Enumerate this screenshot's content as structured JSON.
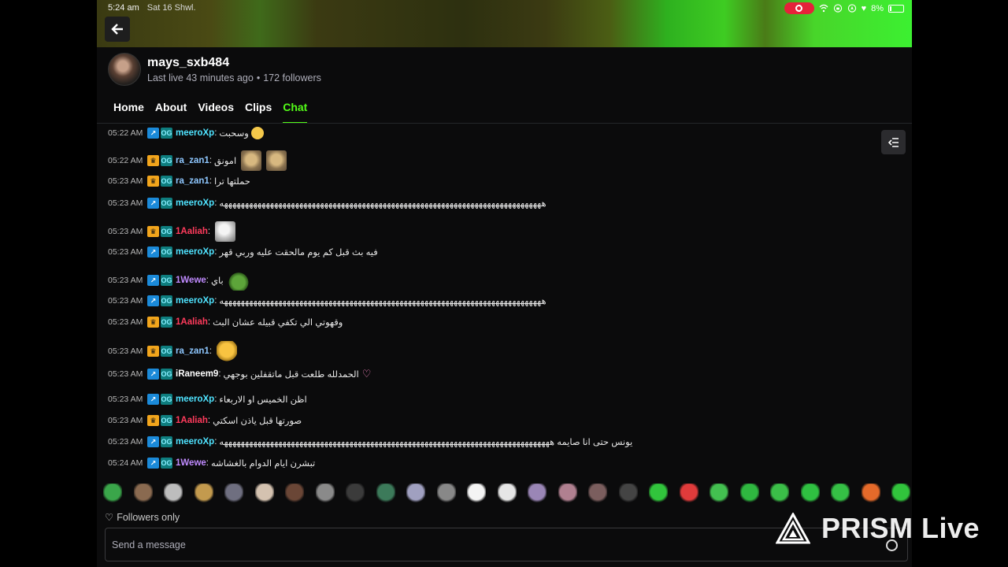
{
  "status_bar": {
    "time": "5:24 am",
    "date": "Sat 16 Shwl.",
    "battery": "8%"
  },
  "channel": {
    "username": "mays_sxb484",
    "last_live": "Last live 43 minutes ago",
    "followers": "172 followers"
  },
  "tabs": [
    {
      "label": "Home",
      "active": false
    },
    {
      "label": "About",
      "active": false
    },
    {
      "label": "Videos",
      "active": false
    },
    {
      "label": "Clips",
      "active": false
    },
    {
      "label": "Chat",
      "active": true
    }
  ],
  "colors": {
    "accent": "#53fc18",
    "user_meero": "#4fe3ff",
    "user_razan": "#8ec7ff",
    "user_aaliah": "#ff3b5c",
    "user_wewe": "#c08bff",
    "user_iraneem": "#ffffff"
  },
  "chat": [
    {
      "time": "05:22 AM",
      "badges": [
        "arrow-badge-icon",
        "og-badge-icon"
      ],
      "user": "meeroXp",
      "color": "#4fe3ff",
      "text": "وسحبت",
      "emotes": [
        "small-smile"
      ]
    },
    {
      "time": "05:22 AM",
      "badges": [
        "crown-badge-icon",
        "og-badge-icon"
      ],
      "user": "ra_zan1",
      "color": "#8ec7ff",
      "text": "امونق",
      "emotes": [
        "bear",
        "bear"
      ]
    },
    {
      "time": "05:23 AM",
      "badges": [
        "crown-badge-icon",
        "og-badge-icon"
      ],
      "user": "ra_zan1",
      "color": "#8ec7ff",
      "text": "حملتها ترا",
      "emotes": []
    },
    {
      "time": "05:23 AM",
      "badges": [
        "arrow-badge-icon",
        "og-badge-icon"
      ],
      "user": "meeroXp",
      "color": "#4fe3ff",
      "text": "هههههههههههههههههههههههههههههههههههههههههههههههههههههههههههههههههههههههههههههه",
      "emotes": []
    },
    {
      "time": "05:23 AM",
      "badges": [
        "crown-badge-icon",
        "og-badge-icon"
      ],
      "user": "1Aaliah",
      "color": "#ff3b5c",
      "text": "",
      "emotes": [
        "duck"
      ]
    },
    {
      "time": "05:23 AM",
      "badges": [
        "arrow-badge-icon",
        "og-badge-icon"
      ],
      "user": "meeroXp",
      "color": "#4fe3ff",
      "text": "فيه بث قبل كم يوم مالحقت عليه وربي قهر",
      "emotes": []
    },
    {
      "time": "05:23 AM",
      "badges": [
        "arrow-badge-icon",
        "og-badge-icon"
      ],
      "user": "1Wewe",
      "color": "#c08bff",
      "text": "باي",
      "emotes": [
        "frog"
      ]
    },
    {
      "time": "05:23 AM",
      "badges": [
        "arrow-badge-icon",
        "og-badge-icon"
      ],
      "user": "meeroXp",
      "color": "#4fe3ff",
      "text": "هههههههههههههههههههههههههههههههههههههههههههههههههههههههههههههههههههههههههههههه",
      "emotes": []
    },
    {
      "time": "05:23 AM",
      "badges": [
        "crown-badge-icon",
        "og-badge-icon"
      ],
      "user": "1Aaliah",
      "color": "#ff3b5c",
      "text": "وقهوتي الي تكفي قبيله عشان البث",
      "emotes": []
    },
    {
      "time": "05:23 AM",
      "badges": [
        "crown-badge-icon",
        "og-badge-icon"
      ],
      "user": "ra_zan1",
      "color": "#8ec7ff",
      "text": "",
      "emotes": [
        "hug"
      ]
    },
    {
      "time": "05:23 AM",
      "badges": [
        "arrow-badge-icon",
        "og-badge-icon"
      ],
      "user": "iRaneem9",
      "color": "#ffffff",
      "text": "الحمدلله طلعت قبل ماتقفلين بوجهي",
      "emotes": [
        "heart"
      ]
    },
    {
      "time": "05:23 AM",
      "badges": [
        "arrow-badge-icon",
        "og-badge-icon"
      ],
      "user": "meeroXp",
      "color": "#4fe3ff",
      "text": "اظن الخميس او الاربعاء",
      "emotes": []
    },
    {
      "time": "05:23 AM",
      "badges": [
        "crown-badge-icon",
        "og-badge-icon"
      ],
      "user": "1Aaliah",
      "color": "#ff3b5c",
      "text": "صورتها قبل ياذن اسكتي",
      "emotes": []
    },
    {
      "time": "05:23 AM",
      "badges": [
        "arrow-badge-icon",
        "og-badge-icon"
      ],
      "user": "meeroXp",
      "color": "#4fe3ff",
      "text": "يونس حتى انا صايمه هههههههههههههههههههههههههههههههههههههههههههههههههههههههههههههههههههههههههههههههه",
      "emotes": []
    },
    {
      "time": "05:24 AM",
      "badges": [
        "arrow-badge-icon",
        "og-badge-icon"
      ],
      "user": "1Wewe",
      "color": "#c08bff",
      "text": "تبشرن ايام الدوام بالغشاشه",
      "emotes": []
    }
  ],
  "emote_strip": [
    "#3aa64a",
    "#8a6a50",
    "#bdbdbd",
    "#c39a4e",
    "#6f6f80",
    "#d4c2b0",
    "#6a4636",
    "#8a8a8a",
    "#3b3b3b",
    "#3c7a5a",
    "#a0a0c0",
    "#888888",
    "#f4f4f4",
    "#e6e6e6",
    "#9a86b6",
    "#b08090",
    "#7b5e5e",
    "#444444",
    "#31c43c",
    "#e03b3b",
    "#43c050",
    "#2fb840",
    "#3bbf48",
    "#2fc041",
    "#35c045",
    "#e56a2a",
    "#31c43c"
  ],
  "followers_only": "Followers only",
  "message_placeholder": "Send a message",
  "watermark": "PRISM Live"
}
